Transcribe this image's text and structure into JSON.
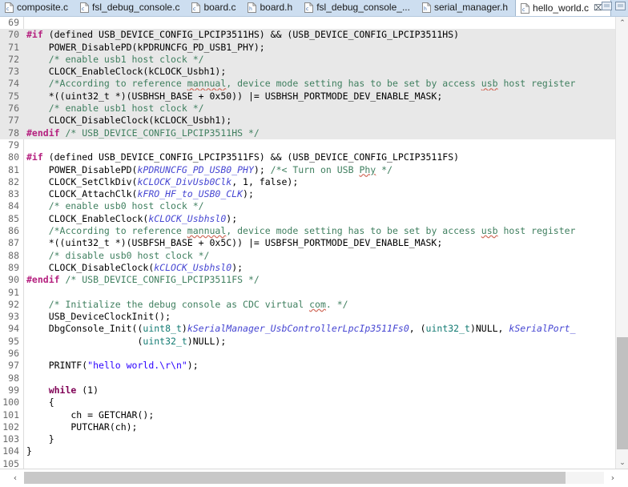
{
  "window": {
    "controls": [
      {
        "name": "minimize-button",
        "label": ""
      },
      {
        "name": "maximize-button",
        "label": ""
      }
    ]
  },
  "tabbar": {
    "tabs": [
      {
        "label": "composite.c",
        "icon": "c-source-file-icon",
        "active": false,
        "close": ""
      },
      {
        "label": "fsl_debug_console.c",
        "icon": "c-source-file-icon",
        "active": false,
        "close": ""
      },
      {
        "label": "board.c",
        "icon": "c-source-file-icon",
        "active": false,
        "close": ""
      },
      {
        "label": "board.h",
        "icon": "c-header-file-icon",
        "active": false,
        "close": ""
      },
      {
        "label": "fsl_debug_console_...",
        "icon": "c-source-file-icon",
        "active": false,
        "close": ""
      },
      {
        "label": "serial_manager.h",
        "icon": "c-header-file-icon",
        "active": false,
        "close": ""
      },
      {
        "label": "hello_world.c",
        "icon": "c-source-file-icon",
        "active": true,
        "close": "⌧"
      }
    ]
  },
  "editor": {
    "language": "C",
    "first_visible_line": 69,
    "last_visible_line": 105,
    "lines": [
      {
        "n": "69",
        "dim": false,
        "tokens": []
      },
      {
        "n": "70",
        "dim": true,
        "tokens": [
          {
            "t": "#if",
            "c": "pp"
          },
          {
            "t": " (defined USB_DEVICE_CONFIG_LPCIP3511HS) && (USB_DEVICE_CONFIG_LPCIP3511HS)",
            "c": "plain"
          }
        ]
      },
      {
        "n": "71",
        "dim": true,
        "tokens": [
          {
            "t": "    POWER_DisablePD(kPDRUNCFG_PD_USB1_PHY);",
            "c": "plain"
          }
        ]
      },
      {
        "n": "72",
        "dim": true,
        "tokens": [
          {
            "t": "    /* enable usb1 host clock */",
            "c": "cmt"
          }
        ]
      },
      {
        "n": "73",
        "dim": true,
        "tokens": [
          {
            "t": "    CLOCK_EnableClock(kCLOCK_Usbh1);",
            "c": "plain"
          }
        ]
      },
      {
        "n": "74",
        "dim": true,
        "tokens": [
          {
            "t": "    /*According to reference ",
            "c": "cmt"
          },
          {
            "t": "mannual",
            "c": "cmt sq"
          },
          {
            "t": ", device mode setting has to be set by access ",
            "c": "cmt"
          },
          {
            "t": "usb",
            "c": "cmt sq"
          },
          {
            "t": " host register",
            "c": "cmt"
          }
        ]
      },
      {
        "n": "75",
        "dim": true,
        "tokens": [
          {
            "t": "    *((uint32_t *)(USBHSH_BASE + 0x50)) |= USBHSH_PORTMODE_DEV_ENABLE_MASK;",
            "c": "plain"
          }
        ]
      },
      {
        "n": "76",
        "dim": true,
        "tokens": [
          {
            "t": "    /* enable usb1 host clock */",
            "c": "cmt"
          }
        ]
      },
      {
        "n": "77",
        "dim": true,
        "tokens": [
          {
            "t": "    CLOCK_DisableClock(kCLOCK_Usbh1);",
            "c": "plain"
          }
        ]
      },
      {
        "n": "78",
        "dim": true,
        "tokens": [
          {
            "t": "#endif",
            "c": "pp"
          },
          {
            "t": " ",
            "c": "plain"
          },
          {
            "t": "/* USB_DEVICE_CONFIG_LPCIP3511HS */",
            "c": "cmt"
          }
        ]
      },
      {
        "n": "79",
        "dim": false,
        "tokens": []
      },
      {
        "n": "80",
        "dim": false,
        "tokens": [
          {
            "t": "#if",
            "c": "pp"
          },
          {
            "t": " (defined USB_DEVICE_CONFIG_LPCIP3511FS) && (USB_DEVICE_CONFIG_LPCIP3511FS)",
            "c": "plain"
          }
        ]
      },
      {
        "n": "81",
        "dim": false,
        "tokens": [
          {
            "t": "    POWER_DisablePD(",
            "c": "plain"
          },
          {
            "t": "kPDRUNCFG_PD_USB0_PHY",
            "c": "fld"
          },
          {
            "t": "); ",
            "c": "plain"
          },
          {
            "t": "/*< Turn on USB ",
            "c": "cmt"
          },
          {
            "t": "Phy",
            "c": "cmt sq"
          },
          {
            "t": " */",
            "c": "cmt"
          }
        ]
      },
      {
        "n": "82",
        "dim": false,
        "tokens": [
          {
            "t": "    CLOCK_SetClkDiv(",
            "c": "plain"
          },
          {
            "t": "kCLOCK_DivUsb0Clk",
            "c": "fld"
          },
          {
            "t": ", 1, false);",
            "c": "plain"
          }
        ]
      },
      {
        "n": "83",
        "dim": false,
        "tokens": [
          {
            "t": "    CLOCK_AttachClk(",
            "c": "plain"
          },
          {
            "t": "kFRO_HF_to_USB0_CLK",
            "c": "fld"
          },
          {
            "t": ");",
            "c": "plain"
          }
        ]
      },
      {
        "n": "84",
        "dim": false,
        "tokens": [
          {
            "t": "    /* enable usb0 host clock */",
            "c": "cmt"
          }
        ]
      },
      {
        "n": "85",
        "dim": false,
        "tokens": [
          {
            "t": "    CLOCK_EnableClock(",
            "c": "plain"
          },
          {
            "t": "kCLOCK_Usbhsl0",
            "c": "fld"
          },
          {
            "t": ");",
            "c": "plain"
          }
        ]
      },
      {
        "n": "86",
        "dim": false,
        "tokens": [
          {
            "t": "    /*According to reference ",
            "c": "cmt"
          },
          {
            "t": "mannual",
            "c": "cmt sq"
          },
          {
            "t": ", device mode setting has to be set by access ",
            "c": "cmt"
          },
          {
            "t": "usb",
            "c": "cmt sq"
          },
          {
            "t": " host register",
            "c": "cmt"
          }
        ]
      },
      {
        "n": "87",
        "dim": false,
        "tokens": [
          {
            "t": "    *((uint32_t *)(USBFSH_BASE + 0x5C)) |= USBFSH_PORTMODE_DEV_ENABLE_MASK;",
            "c": "plain"
          }
        ]
      },
      {
        "n": "88",
        "dim": false,
        "tokens": [
          {
            "t": "    /* disable usb0 host clock */",
            "c": "cmt"
          }
        ]
      },
      {
        "n": "89",
        "dim": false,
        "tokens": [
          {
            "t": "    CLOCK_DisableClock(",
            "c": "plain"
          },
          {
            "t": "kCLOCK_Usbhsl0",
            "c": "fld"
          },
          {
            "t": ");",
            "c": "plain"
          }
        ]
      },
      {
        "n": "90",
        "dim": false,
        "tokens": [
          {
            "t": "#endif",
            "c": "pp"
          },
          {
            "t": " ",
            "c": "plain"
          },
          {
            "t": "/* USB_DEVICE_CONFIG_LPCIP3511FS */",
            "c": "cmt"
          }
        ]
      },
      {
        "n": "91",
        "dim": false,
        "tokens": []
      },
      {
        "n": "92",
        "dim": false,
        "tokens": [
          {
            "t": "    /* Initialize the debug console as CDC virtual ",
            "c": "cmt"
          },
          {
            "t": "com",
            "c": "cmt sq"
          },
          {
            "t": ". */",
            "c": "cmt"
          }
        ]
      },
      {
        "n": "93",
        "dim": false,
        "tokens": [
          {
            "t": "    USB_DeviceClockInit();",
            "c": "plain"
          }
        ]
      },
      {
        "n": "94",
        "dim": false,
        "tokens": [
          {
            "t": "    DbgConsole_Init((",
            "c": "plain"
          },
          {
            "t": "uint8_t",
            "c": "typ"
          },
          {
            "t": ")",
            "c": "plain"
          },
          {
            "t": "kSerialManager_UsbControllerLpcIp3511Fs0",
            "c": "fld"
          },
          {
            "t": ", (",
            "c": "plain"
          },
          {
            "t": "uint32_t",
            "c": "typ"
          },
          {
            "t": ")NULL, ",
            "c": "plain"
          },
          {
            "t": "kSerialPort_",
            "c": "fld"
          }
        ]
      },
      {
        "n": "95",
        "dim": false,
        "tokens": [
          {
            "t": "                    (",
            "c": "plain"
          },
          {
            "t": "uint32_t",
            "c": "typ"
          },
          {
            "t": ")NULL);",
            "c": "plain"
          }
        ]
      },
      {
        "n": "96",
        "dim": false,
        "tokens": []
      },
      {
        "n": "97",
        "dim": false,
        "tokens": [
          {
            "t": "    PRINTF(",
            "c": "plain"
          },
          {
            "t": "\"hello world.\\r\\n\"",
            "c": "str"
          },
          {
            "t": ");",
            "c": "plain"
          }
        ]
      },
      {
        "n": "98",
        "dim": false,
        "tokens": []
      },
      {
        "n": "99",
        "dim": false,
        "tokens": [
          {
            "t": "    ",
            "c": "plain"
          },
          {
            "t": "while",
            "c": "kw"
          },
          {
            "t": " (1)",
            "c": "plain"
          }
        ]
      },
      {
        "n": "100",
        "dim": false,
        "tokens": [
          {
            "t": "    {",
            "c": "plain"
          }
        ]
      },
      {
        "n": "101",
        "dim": false,
        "tokens": [
          {
            "t": "        ch = GETCHAR();",
            "c": "plain"
          }
        ]
      },
      {
        "n": "102",
        "dim": false,
        "tokens": [
          {
            "t": "        PUTCHAR(ch);",
            "c": "plain"
          }
        ]
      },
      {
        "n": "103",
        "dim": false,
        "tokens": [
          {
            "t": "    }",
            "c": "plain"
          }
        ]
      },
      {
        "n": "104",
        "dim": false,
        "tokens": [
          {
            "t": "}",
            "c": "plain"
          }
        ]
      },
      {
        "n": "105",
        "dim": false,
        "tokens": []
      }
    ]
  },
  "scrollbars": {
    "vertical": {
      "up_arrow": "⌃",
      "down_arrow": "⌄"
    },
    "horizontal": {
      "left_arrow": "‹",
      "right_arrow": "›"
    }
  },
  "colors": {
    "tabbar_background": "#cddef0",
    "active_tab_background": "#ffffff",
    "editor_background": "#ffffff",
    "inactive_block_background": "#e8e8e8",
    "line_number": "#6b6b6b",
    "keyword": "#7f0055",
    "preprocessor": "#b5207f",
    "comment": "#3f7f5f",
    "string": "#2a00ff",
    "type": "#137b73",
    "field": "#4646d2",
    "scrollbar_thumb": "#c0c0c0"
  }
}
